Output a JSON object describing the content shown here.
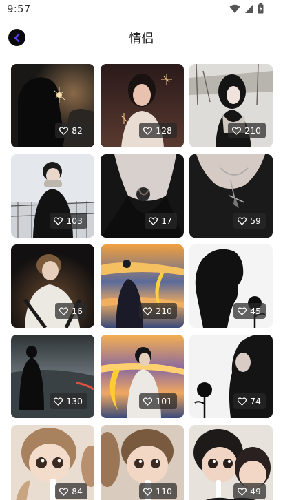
{
  "status_bar": {
    "time": "9:57",
    "icons": [
      "wifi-icon",
      "signal-icon",
      "battery-icon"
    ]
  },
  "header": {
    "back_icon": "chevron-left-icon",
    "title": "情侣",
    "accent_color": "#5b3bf0"
  },
  "grid": {
    "like_icon": "heart-outline-icon",
    "items": [
      {
        "likes": "82"
      },
      {
        "likes": "128"
      },
      {
        "likes": "210"
      },
      {
        "likes": "103"
      },
      {
        "likes": "17"
      },
      {
        "likes": "59"
      },
      {
        "likes": "16"
      },
      {
        "likes": "210"
      },
      {
        "likes": "45"
      },
      {
        "likes": "130"
      },
      {
        "likes": "101"
      },
      {
        "likes": "74"
      },
      {
        "likes": "84"
      },
      {
        "likes": "110"
      },
      {
        "likes": "49"
      }
    ]
  }
}
